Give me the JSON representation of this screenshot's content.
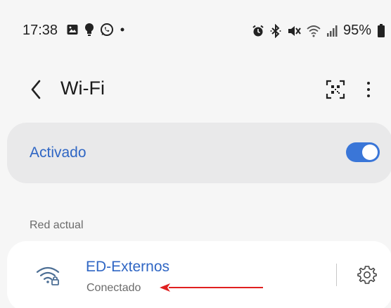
{
  "status_bar": {
    "time": "17:38",
    "left_icons": [
      "gallery-icon",
      "bulb-icon",
      "whatsapp-icon",
      "dot-icon"
    ],
    "right_icons": [
      "alarm-icon",
      "bluetooth-icon",
      "mute-icon",
      "wifi-signal-icon",
      "cell-signal-icon"
    ],
    "battery": "95%"
  },
  "header": {
    "title": "Wi-Fi",
    "back_icon": "chevron-left-icon",
    "qr_icon": "qr-scan-icon",
    "menu_icon": "more-vertical-icon"
  },
  "wifi_toggle": {
    "label": "Activado",
    "state": "on",
    "accent_color": "#3a76d8"
  },
  "current_network": {
    "section_label": "Red actual",
    "name": "ED-Externos",
    "status": "Conectado",
    "icon": "wifi-lock-icon",
    "settings_icon": "gear-icon"
  },
  "annotation": {
    "type": "arrow",
    "color": "#e02020"
  }
}
